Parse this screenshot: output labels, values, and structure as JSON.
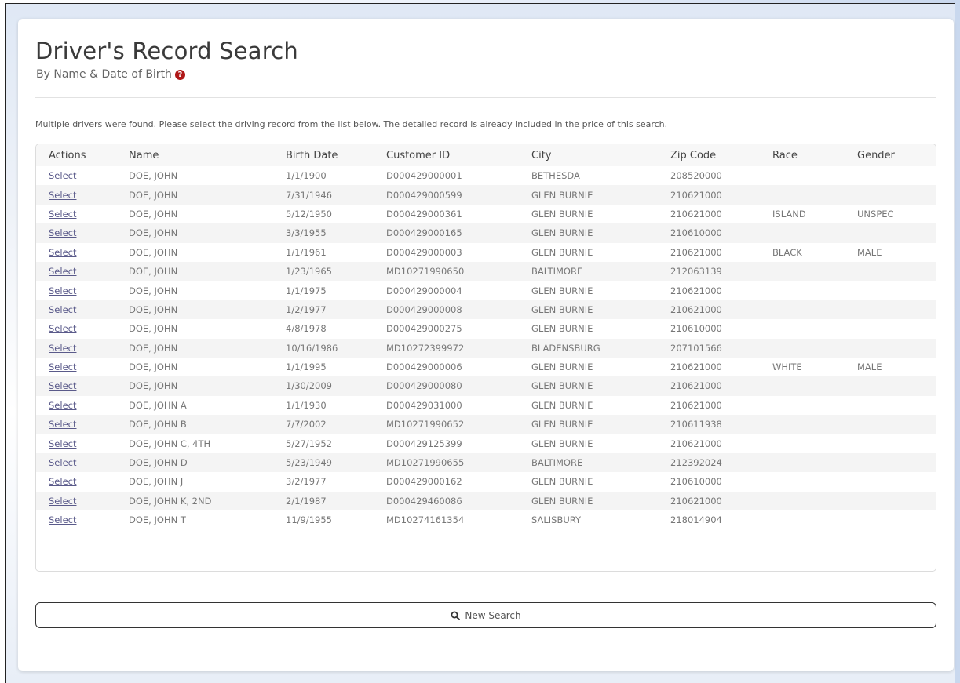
{
  "page": {
    "title": "Driver's Record Search",
    "subtitle": "By Name & Date of Birth",
    "help_glyph": "?",
    "info": "Multiple drivers were found. Please select the driving record from the list below. The detailed record is already included in the price of this search."
  },
  "table": {
    "headers": [
      "Actions",
      "Name",
      "Birth Date",
      "Customer ID",
      "City",
      "Zip Code",
      "Race",
      "Gender"
    ],
    "action_label": "Select",
    "rows": [
      [
        "DOE, JOHN",
        "1/1/1900",
        "D000429000001",
        "BETHESDA",
        "208520000",
        "",
        ""
      ],
      [
        "DOE, JOHN",
        "7/31/1946",
        "D000429000599",
        "GLEN BURNIE",
        "210621000",
        "",
        ""
      ],
      [
        "DOE, JOHN",
        "5/12/1950",
        "D000429000361",
        "GLEN BURNIE",
        "210621000",
        "ISLAND",
        "UNSPEC"
      ],
      [
        "DOE, JOHN",
        "3/3/1955",
        "D000429000165",
        "GLEN BURNIE",
        "210610000",
        "",
        ""
      ],
      [
        "DOE, JOHN",
        "1/1/1961",
        "D000429000003",
        "GLEN BURNIE",
        "210621000",
        "BLACK",
        "MALE"
      ],
      [
        "DOE, JOHN",
        "1/23/1965",
        "MD10271990650",
        "BALTIMORE",
        "212063139",
        "",
        ""
      ],
      [
        "DOE, JOHN",
        "1/1/1975",
        "D000429000004",
        "GLEN BURNIE",
        "210621000",
        "",
        ""
      ],
      [
        "DOE, JOHN",
        "1/2/1977",
        "D000429000008",
        "GLEN BURNIE",
        "210621000",
        "",
        ""
      ],
      [
        "DOE, JOHN",
        "4/8/1978",
        "D000429000275",
        "GLEN BURNIE",
        "210610000",
        "",
        ""
      ],
      [
        "DOE, JOHN",
        "10/16/1986",
        "MD10272399972",
        "BLADENSBURG",
        "207101566",
        "",
        ""
      ],
      [
        "DOE, JOHN",
        "1/1/1995",
        "D000429000006",
        "GLEN BURNIE",
        "210621000",
        "WHITE",
        "MALE"
      ],
      [
        "DOE, JOHN",
        "1/30/2009",
        "D000429000080",
        "GLEN BURNIE",
        "210621000",
        "",
        ""
      ],
      [
        "DOE, JOHN A",
        "1/1/1930",
        "D000429031000",
        "GLEN BURNIE",
        "210621000",
        "",
        ""
      ],
      [
        "DOE, JOHN B",
        "7/7/2002",
        "MD10271990652",
        "GLEN BURNIE",
        "210611938",
        "",
        ""
      ],
      [
        "DOE, JOHN C, 4TH",
        "5/27/1952",
        "D000429125399",
        "GLEN BURNIE",
        "210621000",
        "",
        ""
      ],
      [
        "DOE, JOHN D",
        "5/23/1949",
        "MD10271990655",
        "BALTIMORE",
        "212392024",
        "",
        ""
      ],
      [
        "DOE, JOHN J",
        "3/2/1977",
        "D000429000162",
        "GLEN BURNIE",
        "210610000",
        "",
        ""
      ],
      [
        "DOE, JOHN K, 2ND",
        "2/1/1987",
        "D000429460086",
        "GLEN BURNIE",
        "210621000",
        "",
        ""
      ],
      [
        "DOE, JOHN T",
        "11/9/1955",
        "MD10274161354",
        "SALISBURY",
        "218014904",
        "",
        ""
      ]
    ]
  },
  "new_search": {
    "label": "New Search",
    "icon": "search-icon"
  },
  "colors": {
    "help_icon": "#b01818",
    "link": "#5a5a8a"
  }
}
